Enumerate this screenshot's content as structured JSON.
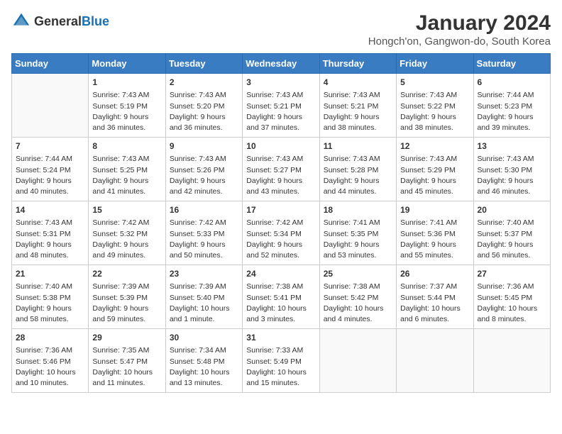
{
  "header": {
    "logo_general": "General",
    "logo_blue": "Blue",
    "title": "January 2024",
    "subtitle": "Hongch'on, Gangwon-do, South Korea"
  },
  "weekdays": [
    "Sunday",
    "Monday",
    "Tuesday",
    "Wednesday",
    "Thursday",
    "Friday",
    "Saturday"
  ],
  "weeks": [
    [
      {
        "day": "",
        "info": ""
      },
      {
        "day": "1",
        "info": "Sunrise: 7:43 AM\nSunset: 5:19 PM\nDaylight: 9 hours and 36 minutes."
      },
      {
        "day": "2",
        "info": "Sunrise: 7:43 AM\nSunset: 5:20 PM\nDaylight: 9 hours and 36 minutes."
      },
      {
        "day": "3",
        "info": "Sunrise: 7:43 AM\nSunset: 5:21 PM\nDaylight: 9 hours and 37 minutes."
      },
      {
        "day": "4",
        "info": "Sunrise: 7:43 AM\nSunset: 5:21 PM\nDaylight: 9 hours and 38 minutes."
      },
      {
        "day": "5",
        "info": "Sunrise: 7:43 AM\nSunset: 5:22 PM\nDaylight: 9 hours and 38 minutes."
      },
      {
        "day": "6",
        "info": "Sunrise: 7:44 AM\nSunset: 5:23 PM\nDaylight: 9 hours and 39 minutes."
      }
    ],
    [
      {
        "day": "7",
        "info": "Sunrise: 7:44 AM\nSunset: 5:24 PM\nDaylight: 9 hours and 40 minutes."
      },
      {
        "day": "8",
        "info": "Sunrise: 7:43 AM\nSunset: 5:25 PM\nDaylight: 9 hours and 41 minutes."
      },
      {
        "day": "9",
        "info": "Sunrise: 7:43 AM\nSunset: 5:26 PM\nDaylight: 9 hours and 42 minutes."
      },
      {
        "day": "10",
        "info": "Sunrise: 7:43 AM\nSunset: 5:27 PM\nDaylight: 9 hours and 43 minutes."
      },
      {
        "day": "11",
        "info": "Sunrise: 7:43 AM\nSunset: 5:28 PM\nDaylight: 9 hours and 44 minutes."
      },
      {
        "day": "12",
        "info": "Sunrise: 7:43 AM\nSunset: 5:29 PM\nDaylight: 9 hours and 45 minutes."
      },
      {
        "day": "13",
        "info": "Sunrise: 7:43 AM\nSunset: 5:30 PM\nDaylight: 9 hours and 46 minutes."
      }
    ],
    [
      {
        "day": "14",
        "info": "Sunrise: 7:43 AM\nSunset: 5:31 PM\nDaylight: 9 hours and 48 minutes."
      },
      {
        "day": "15",
        "info": "Sunrise: 7:42 AM\nSunset: 5:32 PM\nDaylight: 9 hours and 49 minutes."
      },
      {
        "day": "16",
        "info": "Sunrise: 7:42 AM\nSunset: 5:33 PM\nDaylight: 9 hours and 50 minutes."
      },
      {
        "day": "17",
        "info": "Sunrise: 7:42 AM\nSunset: 5:34 PM\nDaylight: 9 hours and 52 minutes."
      },
      {
        "day": "18",
        "info": "Sunrise: 7:41 AM\nSunset: 5:35 PM\nDaylight: 9 hours and 53 minutes."
      },
      {
        "day": "19",
        "info": "Sunrise: 7:41 AM\nSunset: 5:36 PM\nDaylight: 9 hours and 55 minutes."
      },
      {
        "day": "20",
        "info": "Sunrise: 7:40 AM\nSunset: 5:37 PM\nDaylight: 9 hours and 56 minutes."
      }
    ],
    [
      {
        "day": "21",
        "info": "Sunrise: 7:40 AM\nSunset: 5:38 PM\nDaylight: 9 hours and 58 minutes."
      },
      {
        "day": "22",
        "info": "Sunrise: 7:39 AM\nSunset: 5:39 PM\nDaylight: 9 hours and 59 minutes."
      },
      {
        "day": "23",
        "info": "Sunrise: 7:39 AM\nSunset: 5:40 PM\nDaylight: 10 hours and 1 minute."
      },
      {
        "day": "24",
        "info": "Sunrise: 7:38 AM\nSunset: 5:41 PM\nDaylight: 10 hours and 3 minutes."
      },
      {
        "day": "25",
        "info": "Sunrise: 7:38 AM\nSunset: 5:42 PM\nDaylight: 10 hours and 4 minutes."
      },
      {
        "day": "26",
        "info": "Sunrise: 7:37 AM\nSunset: 5:44 PM\nDaylight: 10 hours and 6 minutes."
      },
      {
        "day": "27",
        "info": "Sunrise: 7:36 AM\nSunset: 5:45 PM\nDaylight: 10 hours and 8 minutes."
      }
    ],
    [
      {
        "day": "28",
        "info": "Sunrise: 7:36 AM\nSunset: 5:46 PM\nDaylight: 10 hours and 10 minutes."
      },
      {
        "day": "29",
        "info": "Sunrise: 7:35 AM\nSunset: 5:47 PM\nDaylight: 10 hours and 11 minutes."
      },
      {
        "day": "30",
        "info": "Sunrise: 7:34 AM\nSunset: 5:48 PM\nDaylight: 10 hours and 13 minutes."
      },
      {
        "day": "31",
        "info": "Sunrise: 7:33 AM\nSunset: 5:49 PM\nDaylight: 10 hours and 15 minutes."
      },
      {
        "day": "",
        "info": ""
      },
      {
        "day": "",
        "info": ""
      },
      {
        "day": "",
        "info": ""
      }
    ]
  ]
}
